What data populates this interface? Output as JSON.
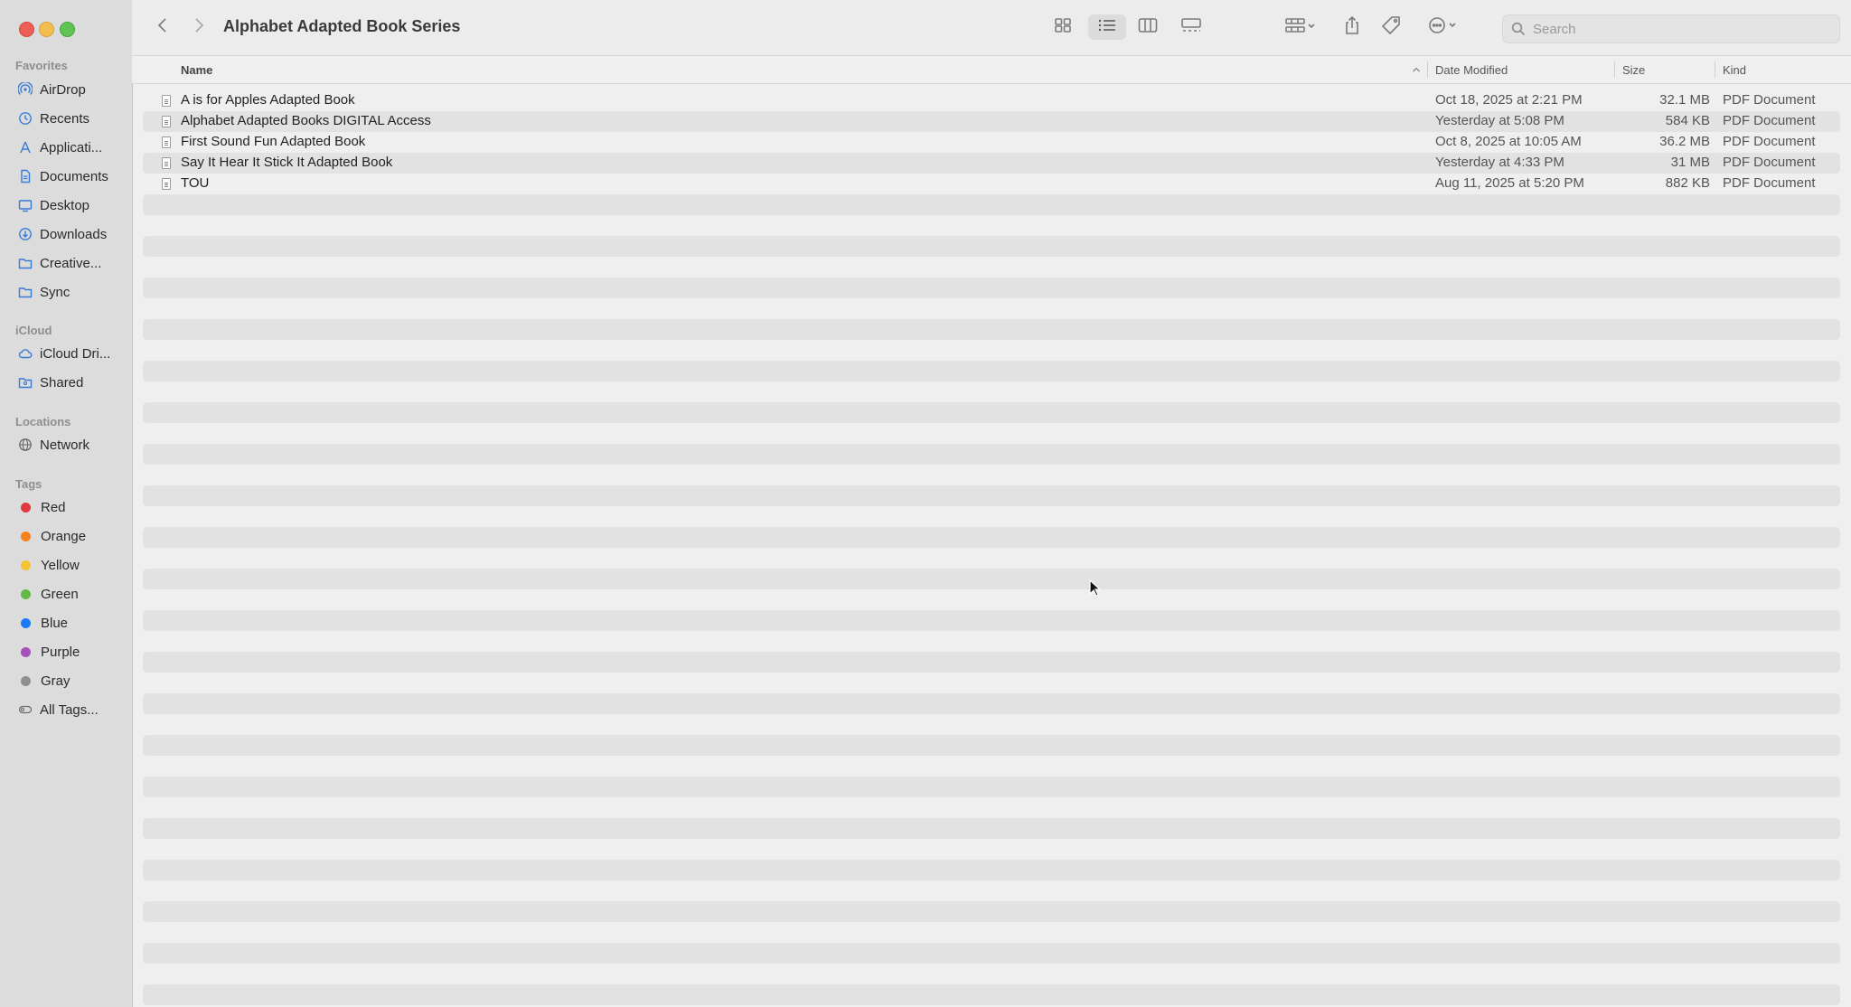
{
  "window": {
    "title": "Alphabet Adapted Book Series"
  },
  "sidebar": {
    "favorites_label": "Favorites",
    "favorites": [
      {
        "label": "AirDrop",
        "icon": "airdrop-icon"
      },
      {
        "label": "Recents",
        "icon": "clock-icon"
      },
      {
        "label": "Applicati...",
        "icon": "applications-icon"
      },
      {
        "label": "Documents",
        "icon": "document-icon"
      },
      {
        "label": "Desktop",
        "icon": "desktop-icon"
      },
      {
        "label": "Downloads",
        "icon": "download-icon"
      },
      {
        "label": "Creative...",
        "icon": "folder-icon"
      },
      {
        "label": "Sync",
        "icon": "folder-icon"
      }
    ],
    "icloud_label": "iCloud",
    "icloud": [
      {
        "label": "iCloud Dri...",
        "icon": "cloud-icon"
      },
      {
        "label": "Shared",
        "icon": "shared-folder-icon"
      }
    ],
    "locations_label": "Locations",
    "locations": [
      {
        "label": "Network",
        "icon": "globe-icon"
      }
    ],
    "tags_label": "Tags",
    "tags": [
      {
        "label": "Red",
        "color": "#e0383e"
      },
      {
        "label": "Orange",
        "color": "#f7821b"
      },
      {
        "label": "Yellow",
        "color": "#f5c330"
      },
      {
        "label": "Green",
        "color": "#62ba46"
      },
      {
        "label": "Blue",
        "color": "#1b7bf7"
      },
      {
        "label": "Purple",
        "color": "#a650be"
      },
      {
        "label": "Gray",
        "color": "#8e8e93"
      }
    ],
    "all_tags": "All Tags..."
  },
  "toolbar": {
    "search_placeholder": "Search"
  },
  "columns": {
    "name": "Name",
    "date_modified": "Date Modified",
    "size": "Size",
    "kind": "Kind"
  },
  "files": [
    {
      "name": "A is for Apples Adapted Book",
      "date": "Oct 18, 2025 at 2:21 PM",
      "size": "32.1 MB",
      "kind": "PDF Document"
    },
    {
      "name": "Alphabet Adapted Books DIGITAL Access",
      "date": "Yesterday at 5:08 PM",
      "size": "584 KB",
      "kind": "PDF Document"
    },
    {
      "name": "First Sound Fun Adapted Book",
      "date": "Oct 8, 2025 at 10:05 AM",
      "size": "36.2 MB",
      "kind": "PDF Document"
    },
    {
      "name": "Say It Hear It Stick It Adapted Book",
      "date": "Yesterday at 4:33 PM",
      "size": "31 MB",
      "kind": "PDF Document"
    },
    {
      "name": "TOU",
      "date": "Aug 11, 2025 at 5:20 PM",
      "size": "882 KB",
      "kind": "PDF Document"
    }
  ]
}
